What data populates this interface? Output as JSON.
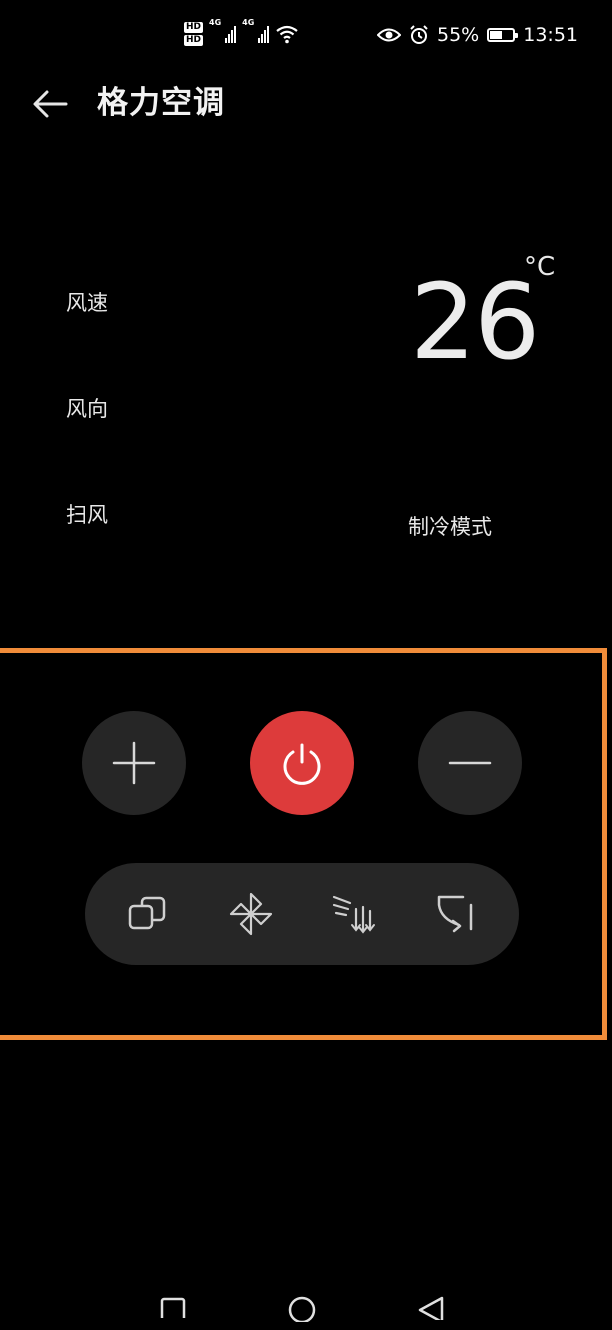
{
  "status_bar": {
    "hd1": "HD",
    "hd2": "HD",
    "network1": "4G",
    "network2": "4G",
    "battery_percent": "55%",
    "battery_level": 0.55,
    "time": "13:51",
    "icons": [
      "hd-icon",
      "signal-icon",
      "signal-icon",
      "wifi-icon",
      "eye-icon",
      "alarm-icon",
      "battery-icon"
    ]
  },
  "header": {
    "title": "格力空调",
    "back_icon": "arrow-left-icon"
  },
  "labels": {
    "fan_speed": "风速",
    "fan_direction": "风向",
    "swing": "扫风",
    "mode": "制冷模式"
  },
  "temperature": {
    "value": "26",
    "unit": "°C"
  },
  "controls": {
    "increase_icon": "plus-icon",
    "power_icon": "power-icon",
    "decrease_icon": "minus-icon",
    "power_color": "#dd3b3b",
    "highlight_color": "#f08c3a",
    "functions": [
      "mode-icon",
      "fan-icon",
      "swing-icon",
      "direction-icon"
    ]
  },
  "navigation": {
    "icons": [
      "recents-square-icon",
      "home-circle-icon",
      "back-triangle-icon"
    ]
  }
}
